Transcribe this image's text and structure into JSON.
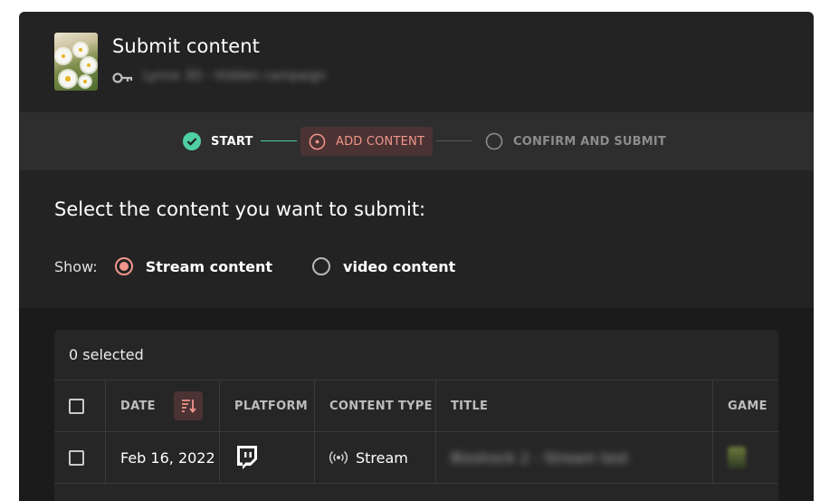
{
  "header": {
    "title": "Submit content",
    "subtitle": "Lynne 3D - Hidden campaign"
  },
  "stepper": {
    "steps": [
      {
        "label": "START",
        "state": "done"
      },
      {
        "label": "ADD CONTENT",
        "state": "active"
      },
      {
        "label": "CONFIRM AND SUBMIT",
        "state": "pending"
      }
    ]
  },
  "content": {
    "prompt": "Select the content you want to submit:",
    "show_label": "Show:",
    "options": [
      {
        "label": "Stream content",
        "selected": true
      },
      {
        "label": "video content",
        "selected": false
      }
    ]
  },
  "table": {
    "selected_count": "0 selected",
    "columns": [
      "DATE",
      "PLATFORM",
      "CONTENT TYPE",
      "TITLE",
      "GAME"
    ],
    "rows": [
      {
        "date": "Feb 16, 2022",
        "platform_icon": "twitch-icon",
        "content_type": "Stream",
        "title": "Bioshock 2 - Stream test",
        "game_icon": "game-cover-thumbnail"
      }
    ]
  },
  "colors": {
    "accent": "#f2958c",
    "success": "#4fcfa4",
    "background": "#232323"
  }
}
